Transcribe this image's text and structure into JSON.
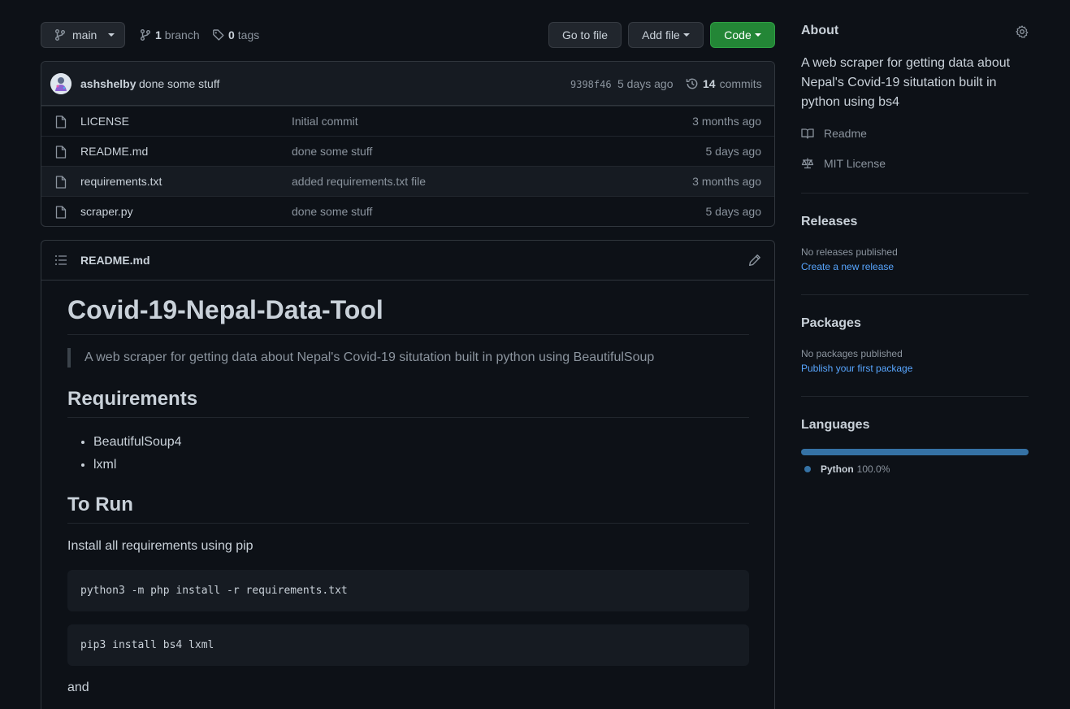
{
  "topbar": {
    "branch": "main",
    "branch_count": "1",
    "branch_label": "branch",
    "tag_count": "0",
    "tag_label": "tags",
    "goto_file": "Go to file",
    "add_file": "Add file",
    "code": "Code"
  },
  "commit": {
    "user": "ashshelby",
    "message": "done some stuff",
    "sha": "9398f46",
    "age": "5 days ago",
    "count": "14",
    "count_label": "commits"
  },
  "files": [
    {
      "name": "LICENSE",
      "message": "Initial commit",
      "age": "3 months ago"
    },
    {
      "name": "README.md",
      "message": "done some stuff",
      "age": "5 days ago"
    },
    {
      "name": "requirements.txt",
      "message": "added requirements.txt file",
      "age": "3 months ago"
    },
    {
      "name": "scraper.py",
      "message": "done some stuff",
      "age": "5 days ago"
    }
  ],
  "readme": {
    "filename": "README.md",
    "h1": "Covid-19-Nepal-Data-Tool",
    "quote": "A web scraper for getting data about Nepal's Covid-19 situtation built in python using BeautifulSoup",
    "h2_requirements": "Requirements",
    "requirements": [
      "BeautifulSoup4",
      "lxml"
    ],
    "h2_run": "To Run",
    "install_text": "Install all requirements using pip",
    "code1": "python3 -m php install -r requirements.txt",
    "code2": "pip3 install bs4 lxml",
    "and_text": "and"
  },
  "sidebar": {
    "about_title": "About",
    "about_text": "A web scraper for getting data about Nepal's Covid-19 situtation built in python using bs4",
    "readme_link": "Readme",
    "license_link": "MIT License",
    "releases_title": "Releases",
    "releases_none": "No releases published",
    "releases_create": "Create a new release",
    "packages_title": "Packages",
    "packages_none": "No packages published",
    "packages_publish": "Publish your first package",
    "languages_title": "Languages",
    "language_name": "Python",
    "language_pct": "100.0%"
  },
  "colors": {
    "background": "#0d1117",
    "primary_button": "#238636",
    "link": "#58a6ff",
    "python": "#3572a5"
  }
}
